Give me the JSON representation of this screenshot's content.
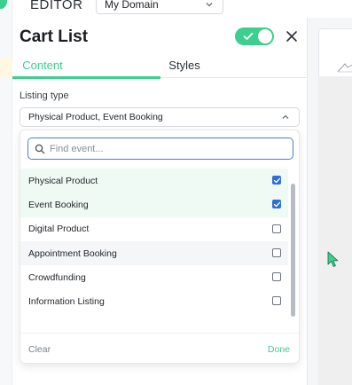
{
  "app": {
    "editor_label": "EDITOR",
    "domain_select": "My Domain"
  },
  "panel": {
    "title": "Cart List",
    "toggle_on": true,
    "tabs": [
      {
        "label": "Content",
        "active": true
      },
      {
        "label": "Styles",
        "active": false
      }
    ],
    "listing_type_label": "Listing type",
    "listing_type_value": "Physical Product, Event Booking"
  },
  "dropdown": {
    "search_placeholder": "Find event...",
    "search_value": "",
    "options": [
      {
        "label": "Physical Product",
        "checked": true
      },
      {
        "label": "Event Booking",
        "checked": true
      },
      {
        "label": "Digital Product",
        "checked": false
      },
      {
        "label": "Appointment Booking",
        "checked": false
      },
      {
        "label": "Crowdfunding",
        "checked": false
      },
      {
        "label": "Information Listing",
        "checked": false
      }
    ],
    "clear_label": "Clear",
    "done_label": "Done"
  },
  "colors": {
    "accent": "#3ccf8e",
    "focus_blue": "#4a7fd4",
    "checkbox_blue": "#2f6fda"
  },
  "icons": {
    "toggle": "check-icon",
    "close": "close-icon",
    "select": "chevron-down-icon",
    "listing_select": "chevron-up-icon",
    "search": "search-icon",
    "cursor": "pointer-cursor-icon"
  }
}
